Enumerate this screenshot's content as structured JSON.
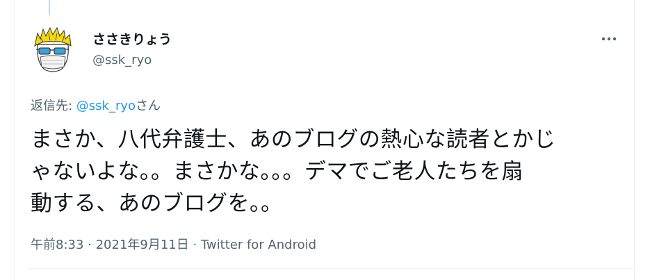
{
  "tweet": {
    "author_name": "ささきりょう",
    "author_handle": "@ssk_ryo",
    "reply_prefix": "返信先: ",
    "reply_mention": "@ssk_ryo",
    "reply_suffix": "さん",
    "text_lines": [
      "まさか、八代弁護士、あのブログの熱心な読者とかじ",
      "ゃないよな。。まさかな。。。デマでご老人たちを扇",
      "動する、あのブログを。。"
    ],
    "timestamp": "午前8:33 · 2021年9月11日 · Twitter for Android"
  },
  "icons": {
    "avatar": "cartoon-avatar-icon",
    "more": "more-dots-icon"
  },
  "colors": {
    "text_primary": "#0f1419",
    "text_secondary": "#536471",
    "link": "#1d9bf0",
    "border": "#eff3f4"
  }
}
